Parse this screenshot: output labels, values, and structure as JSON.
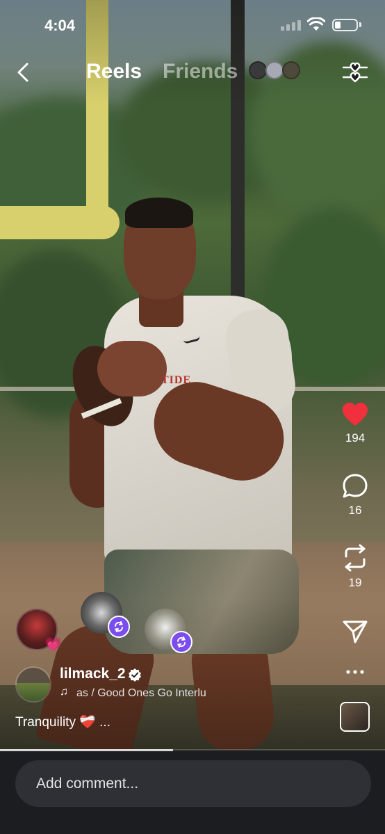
{
  "status_bar": {
    "time": "4:04"
  },
  "nav": {
    "tabs": [
      {
        "label": "Reels",
        "active": true
      },
      {
        "label": "Friends",
        "active": false
      }
    ],
    "friend_avatar_colors": [
      "#3a3a3a",
      "#a7a9b5",
      "#4d4a3c"
    ]
  },
  "actions": {
    "likes": "194",
    "comments": "16",
    "reposts": "19",
    "like_color": "#f0303c"
  },
  "post": {
    "username": "lilmack_2",
    "verified": true,
    "audio": "as / Good Ones Go Interlu",
    "caption": "Tranquility ❤️‍🩹 ..."
  },
  "video": {
    "progress": 0.45
  },
  "comment": {
    "placeholder": "Add comment..."
  },
  "colors": {
    "badge": "#7b4df0",
    "comment_bar": "#1b1d21",
    "comment_field": "#2e3036"
  }
}
